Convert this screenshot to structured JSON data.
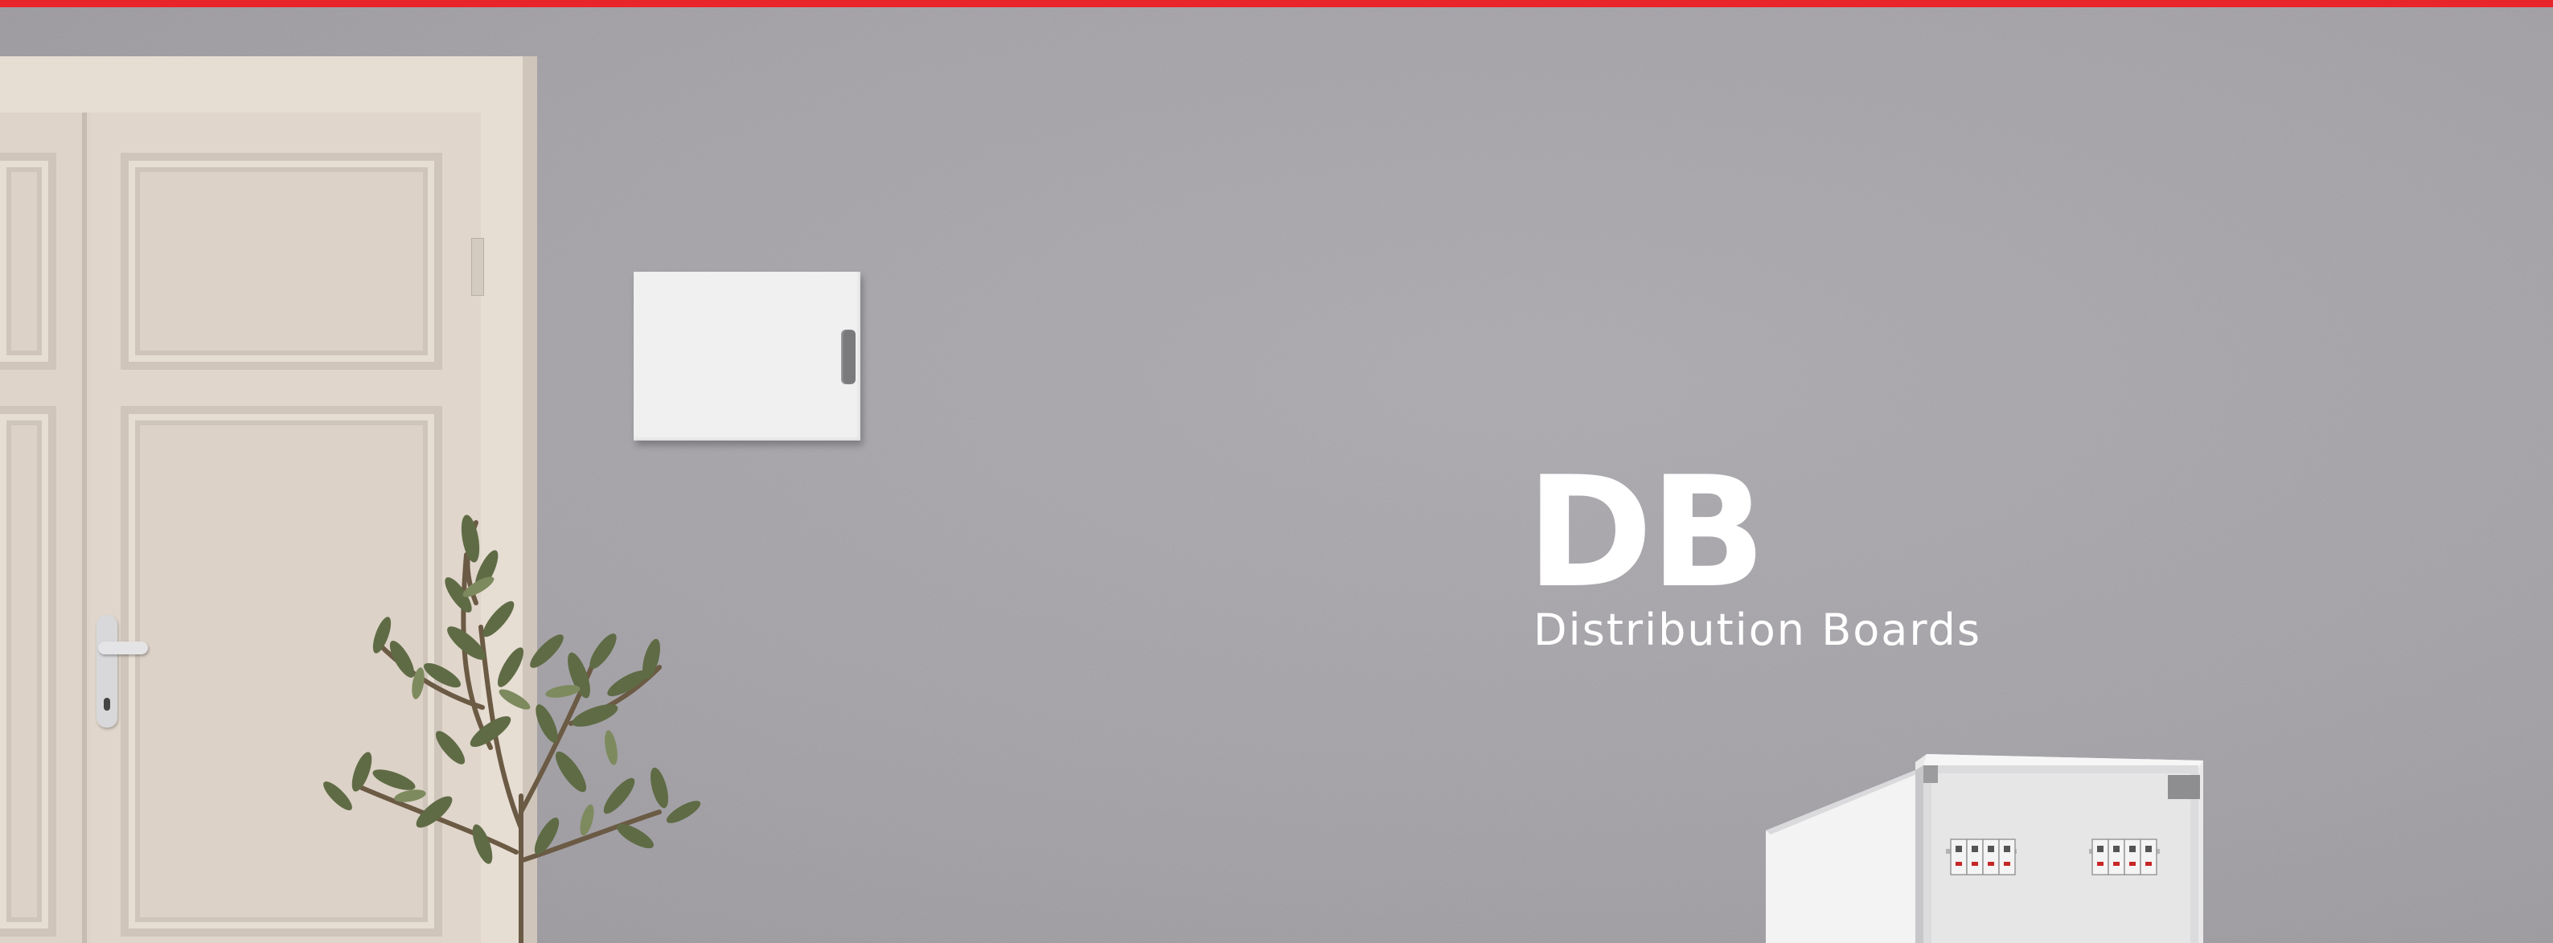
{
  "hero": {
    "title": "DB",
    "subtitle": "Distribution Boards"
  },
  "colors": {
    "accent_bar": "#e8252a",
    "wall": "#a4a2a7",
    "door": "#e0d6cb",
    "text": "#ffffff",
    "wall_box": "#f0f0f0"
  },
  "icons": [
    "door-image",
    "wall-box-image",
    "olive-plant-image",
    "open-distribution-board-image"
  ]
}
